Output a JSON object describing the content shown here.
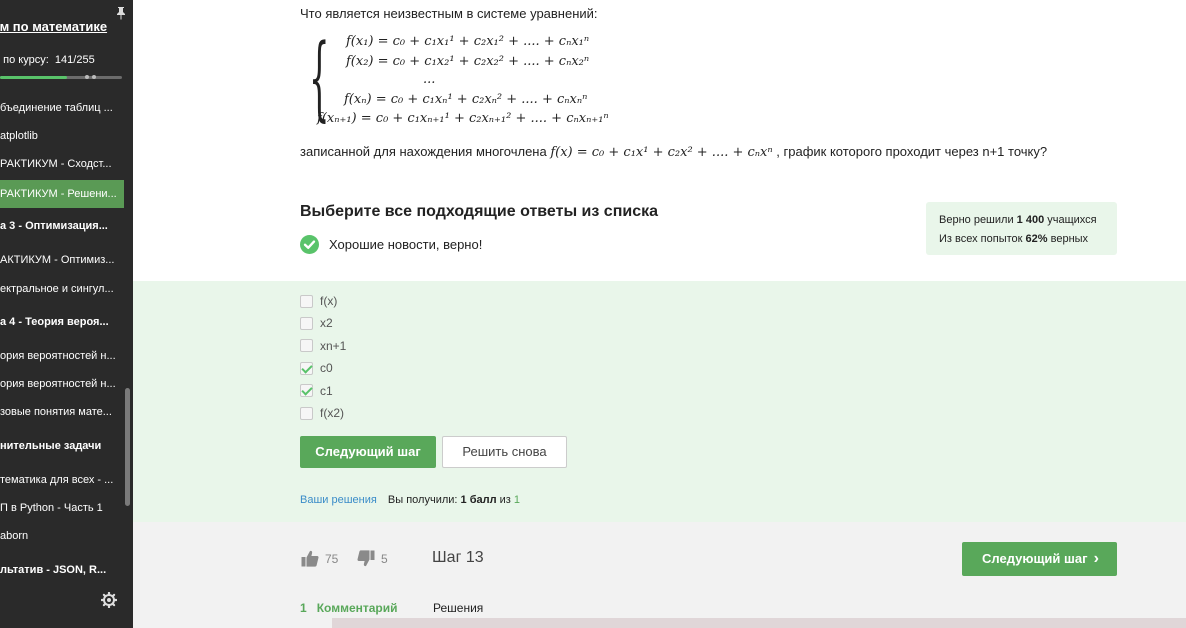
{
  "sidebar": {
    "course_title": "кум по математике\nn",
    "progress_label": "е по курсу:",
    "progress_value": "141/255",
    "progress_fraction": 0.553,
    "items": [
      {
        "label": "бъединение таблиц ...",
        "bold": false,
        "active": false
      },
      {
        "label": "atplotlib",
        "bold": false,
        "active": false
      },
      {
        "label": "РАКТИКУМ - Сходст...",
        "bold": false,
        "active": false
      },
      {
        "label": "РАКТИКУМ - Решени...",
        "bold": false,
        "active": true
      },
      {
        "label": "а 3 - Оптимизация...",
        "bold": true,
        "active": false
      },
      {
        "label": "АКТИКУМ - Оптимиз...",
        "bold": false,
        "active": false
      },
      {
        "label": "ектральное и сингул...",
        "bold": false,
        "active": false
      },
      {
        "label": "а 4 - Теория вероя...",
        "bold": true,
        "active": false
      },
      {
        "label": "ория вероятностей н...",
        "bold": false,
        "active": false
      },
      {
        "label": "ория вероятностей н...",
        "bold": false,
        "active": false
      },
      {
        "label": "зовые понятия мате...",
        "bold": false,
        "active": false
      },
      {
        "label": "нительные задачи",
        "bold": true,
        "active": false
      },
      {
        "label": "тематика для всех - ...",
        "bold": false,
        "active": false
      },
      {
        "label": "П в Python - Часть 1",
        "bold": false,
        "active": false
      },
      {
        "label": "aborn",
        "bold": false,
        "active": false
      },
      {
        "label": "льтатив - JSON, R...",
        "bold": true,
        "active": false
      }
    ]
  },
  "question": {
    "intro": "Что является неизвестным в системе уравнений:",
    "equations": [
      "f(x₁) = c₀ + c₁x₁¹ + c₂x₁² + .... + cₙx₁ⁿ",
      "f(x₂) = c₀ + c₁x₂¹ + c₂x₂² + .... + cₙx₂ⁿ",
      "...",
      "f(xₙ) = c₀ + c₁xₙ¹ + c₂xₙ² + .... + cₙxₙⁿ",
      "f(xₙ₊₁) = c₀ + c₁xₙ₊₁¹ + c₂xₙ₊₁² + .... + cₙxₙ₊₁ⁿ"
    ],
    "tail_before": "записанной для нахождения многочлена",
    "tail_math": "f(x) = c₀ + c₁x¹ + c₂x² + .... + cₙxⁿ",
    "tail_after": ", график которого проходит через n+1 точку?"
  },
  "answer_block": {
    "title": "Выберите все подходящие ответы из списка",
    "feedback": "Хорошие новости, верно!",
    "stats_line1_prefix": "Верно решили",
    "stats_line1_count": "1 400",
    "stats_line1_suffix": "учащихся",
    "stats_line2_prefix": "Из всех попыток",
    "stats_line2_percent": "62%",
    "stats_line2_suffix": "верных"
  },
  "options": [
    {
      "label": "f(x)",
      "checked": false
    },
    {
      "label": "x2",
      "checked": false
    },
    {
      "label": "xn+1",
      "checked": false
    },
    {
      "label": "c0",
      "checked": true
    },
    {
      "label": "c1",
      "checked": true
    },
    {
      "label": "f(x2)",
      "checked": false
    }
  ],
  "actions": {
    "next_step": "Следующий шаг",
    "retry": "Решить снова"
  },
  "result": {
    "solutions_link": "Ваши решения",
    "got_prefix": "Вы получили:",
    "got_score": "1 балл",
    "got_mid": "из",
    "got_max": "1"
  },
  "footer": {
    "likes": "75",
    "dislikes": "5",
    "step": "Шаг 13",
    "next_step": "Следующий шаг",
    "comments_count": "1",
    "comments_label": "Комментарий",
    "solutions_tab": "Решения"
  },
  "colors": {
    "accent_green": "#59a85a",
    "success_bg": "#e9f6ea",
    "sidebar_bg": "#2a2a2a",
    "link_blue": "#3a8cc8"
  }
}
